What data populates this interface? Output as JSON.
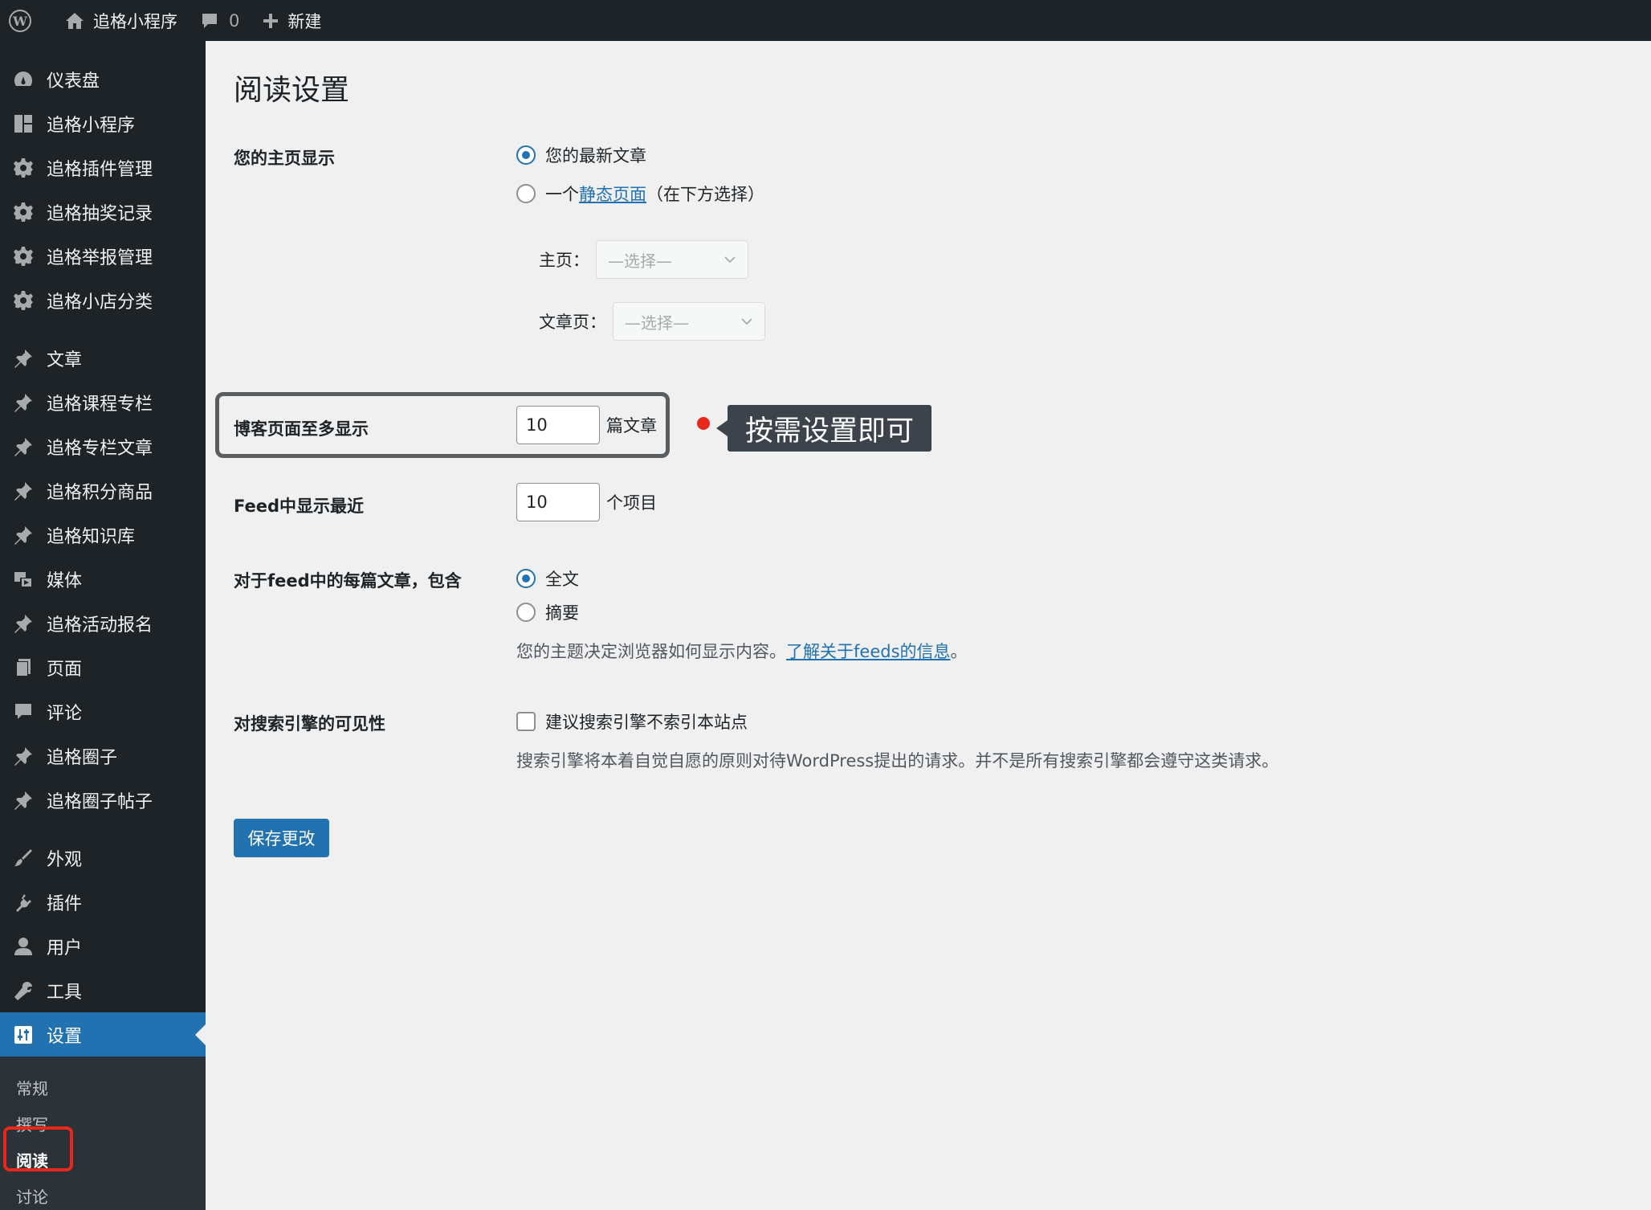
{
  "adminbar": {
    "site_name": "追格小程序",
    "comments_count": "0",
    "new_label": "新建"
  },
  "sidebar": {
    "group1": [
      "仪表盘",
      "追格小程序",
      "追格插件管理",
      "追格抽奖记录",
      "追格举报管理",
      "追格小店分类"
    ],
    "group2": [
      "文章",
      "追格课程专栏",
      "追格专栏文章",
      "追格积分商品",
      "追格知识库",
      "媒体",
      "追格活动报名",
      "页面",
      "评论",
      "追格圈子",
      "追格圈子帖子"
    ],
    "group3": [
      "外观",
      "插件",
      "用户",
      "工具",
      "设置"
    ],
    "submenu": [
      "常规",
      "撰写",
      "阅读",
      "讨论"
    ]
  },
  "main": {
    "title": "阅读设置",
    "homepage": {
      "label": "您的主页显示",
      "option_latest": "您的最新文章",
      "option_static_prefix": "一个",
      "option_static_link": "静态页面",
      "option_static_suffix": "（在下方选择）",
      "front_label": "主页：",
      "front_placeholder": "—选择—",
      "posts_label": "文章页：",
      "posts_placeholder": "—选择—"
    },
    "posts_per_page": {
      "label": "博客页面至多显示",
      "value": "10",
      "unit": "篇文章"
    },
    "callout": "按需设置即可",
    "feed_count": {
      "label": "Feed中显示最近",
      "value": "10",
      "unit": "个项目"
    },
    "feed_content": {
      "label": "对于feed中的每篇文章，包含",
      "option_full": "全文",
      "option_summary": "摘要",
      "desc_prefix": "您的主题决定浏览器如何显示内容。",
      "desc_link": "了解关于feeds的信息",
      "desc_suffix": "。"
    },
    "search_visibility": {
      "label": "对搜索引擎的可见性",
      "checkbox_label": "建议搜索引擎不索引本站点",
      "desc": "搜索引擎将本着自觉自愿的原则对待WordPress提出的请求。并不是所有搜索引擎都会遵守这类请求。"
    },
    "save_button": "保存更改"
  },
  "colors": {
    "accent": "#2271b1",
    "sidebar_bg": "#1d2327",
    "highlight_red": "#e8281a"
  }
}
